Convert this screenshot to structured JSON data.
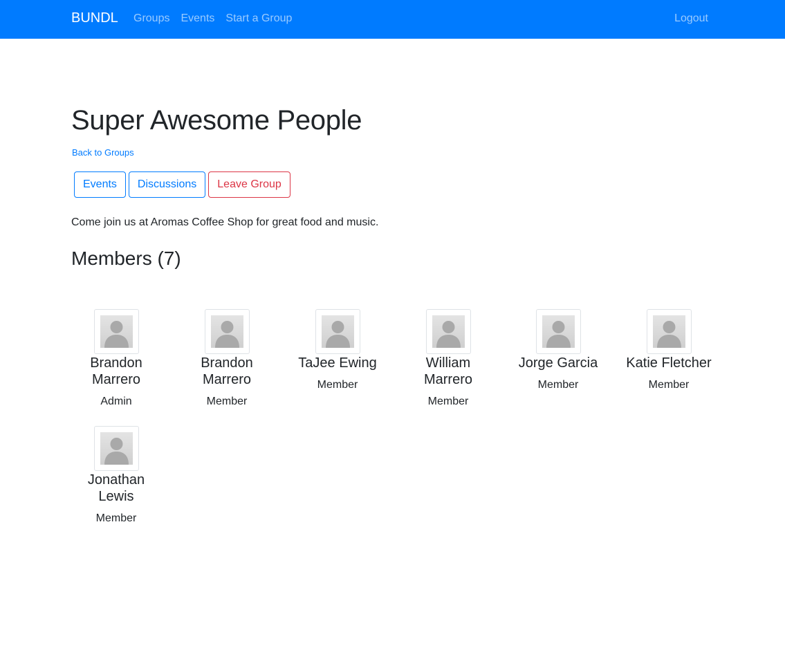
{
  "navbar": {
    "brand": "BUNDL",
    "links": [
      "Groups",
      "Events",
      "Start a Group"
    ],
    "logout": "Logout"
  },
  "group": {
    "title": "Super Awesome People",
    "back_link": "Back to Groups",
    "buttons": {
      "events": "Events",
      "discussions": "Discussions",
      "leave": "Leave Group"
    },
    "description": "Come join us at Aromas Coffee Shop for great food and music."
  },
  "members": {
    "heading": "Members (7)",
    "list": [
      {
        "name_line1": "Brandon",
        "name_line2": "Marrero",
        "role": "Admin",
        "avatar_icon": "user-placeholder-icon"
      },
      {
        "name_line1": "Brandon",
        "name_line2": "Marrero",
        "role": "Member",
        "avatar_icon": "user-placeholder-icon"
      },
      {
        "name_line1": "TaJee Ewing",
        "name_line2": "",
        "role": "Member",
        "avatar_icon": "user-placeholder-icon"
      },
      {
        "name_line1": "William",
        "name_line2": "Marrero",
        "role": "Member",
        "avatar_icon": "user-placeholder-icon"
      },
      {
        "name_line1": "Jorge Garcia",
        "name_line2": "",
        "role": "Member",
        "avatar_icon": "user-placeholder-icon"
      },
      {
        "name_line1": "Katie Fletcher",
        "name_line2": "",
        "role": "Member",
        "avatar_icon": "user-placeholder-icon"
      },
      {
        "name_line1": "Jonathan",
        "name_line2": "Lewis",
        "role": "Member",
        "avatar_icon": "user-placeholder-icon"
      }
    ]
  },
  "colors": {
    "navbar": "#007bff",
    "primary": "#007bff",
    "danger": "#dc3545"
  }
}
